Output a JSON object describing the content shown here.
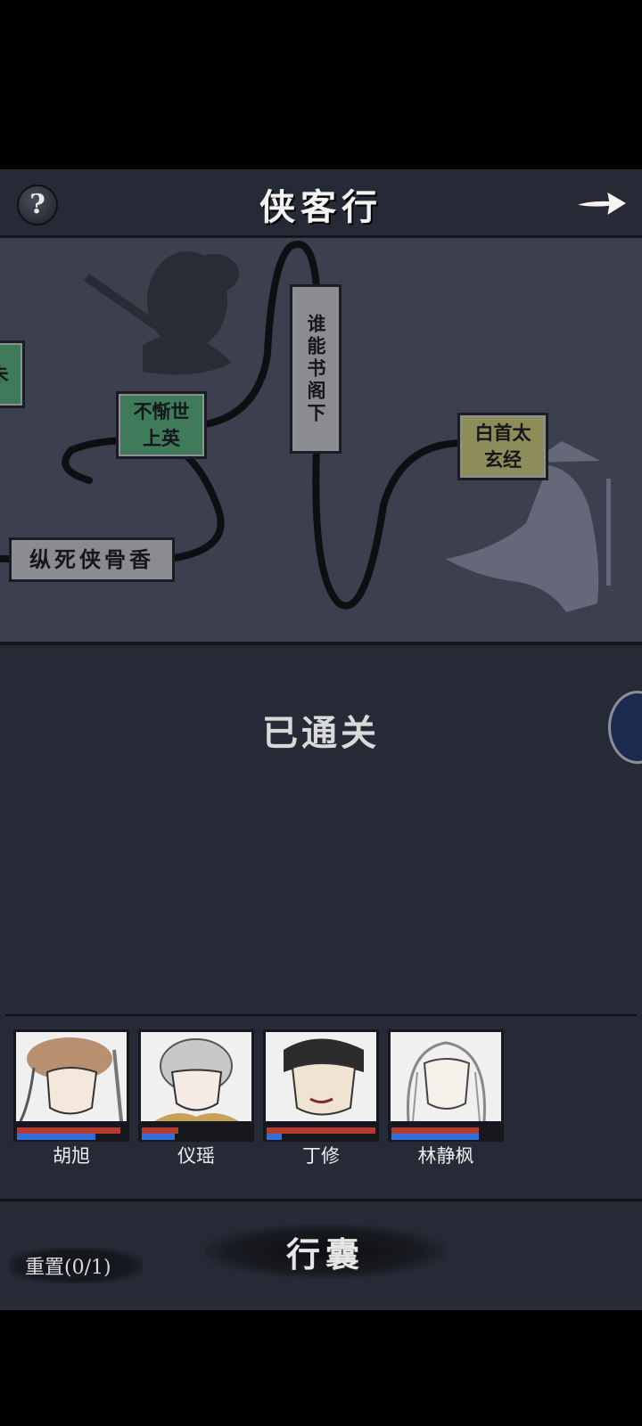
{
  "header": {
    "help_label": "?",
    "title": "侠客行",
    "next_label": "→"
  },
  "map": {
    "nodes": [
      {
        "label": "不惭世上英",
        "color": "green"
      },
      {
        "label": "谁能书阁下",
        "color": "gray"
      },
      {
        "label": "白首太玄经",
        "color": "olive"
      },
      {
        "label": "纵死侠骨香",
        "color": "gray"
      },
      {
        "label": "朱",
        "color": "green"
      }
    ]
  },
  "status_text": "已通关",
  "party": [
    {
      "name": "胡旭",
      "hp": 0.95,
      "mp": 0.72
    },
    {
      "name": "仪瑶",
      "hp": 0.34,
      "mp": 0.3
    },
    {
      "name": "丁修",
      "hp": 1.0,
      "mp": 0.14
    },
    {
      "name": "林静枫",
      "hp": 0.8,
      "mp": 0.8
    }
  ],
  "footer": {
    "bag_label": "行囊",
    "reset_label": "重置(0/1)"
  },
  "colors": {
    "background": "#262a36",
    "map_bg": "#3b3f4e",
    "node_green": "#3f7a5a",
    "node_gray": "#8a8c92",
    "node_olive": "#8d8d5a",
    "hp": "#b53a30",
    "mp": "#2f6fdc"
  }
}
